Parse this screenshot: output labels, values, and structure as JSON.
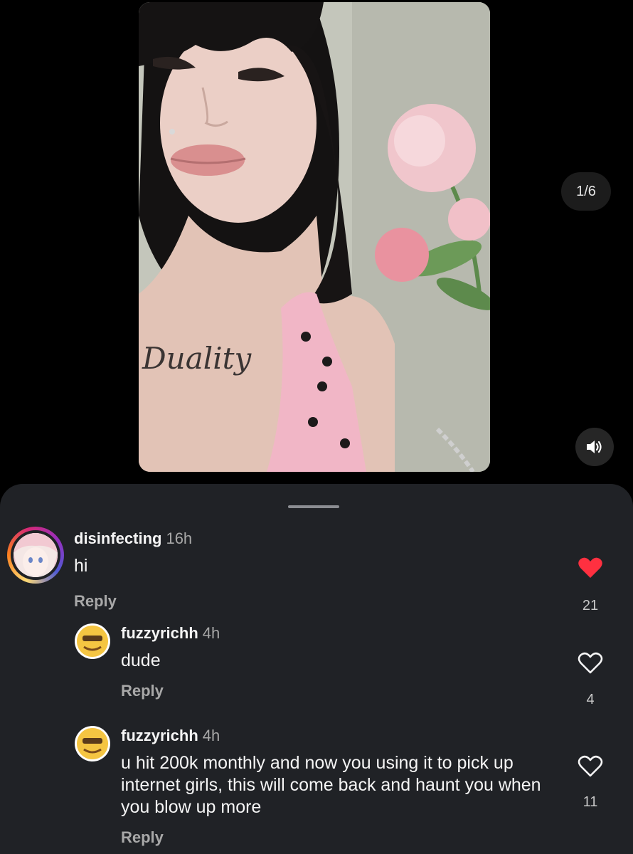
{
  "post": {
    "page_counter": "1/6",
    "image_icon": "photo",
    "sound_icon": "speaker-icon"
  },
  "comments": [
    {
      "username": "disinfecting",
      "time": "16h",
      "text": "hi",
      "reply_label": "Reply",
      "likes": "21",
      "liked": true
    },
    {
      "username": "fuzzyrichh",
      "time": "4h",
      "text": "dude",
      "reply_label": "Reply",
      "likes": "4",
      "liked": false
    },
    {
      "username": "fuzzyrichh",
      "time": "4h",
      "text": "u hit 200k monthly and now you using it to pick up internet girls, this will come back and haunt you when you blow up more",
      "reply_label": "Reply",
      "likes": "11",
      "liked": false
    }
  ],
  "colors": {
    "like_active": "#ff3040",
    "sheet_background": "#202226",
    "secondary_text": "#a8a8a8"
  }
}
